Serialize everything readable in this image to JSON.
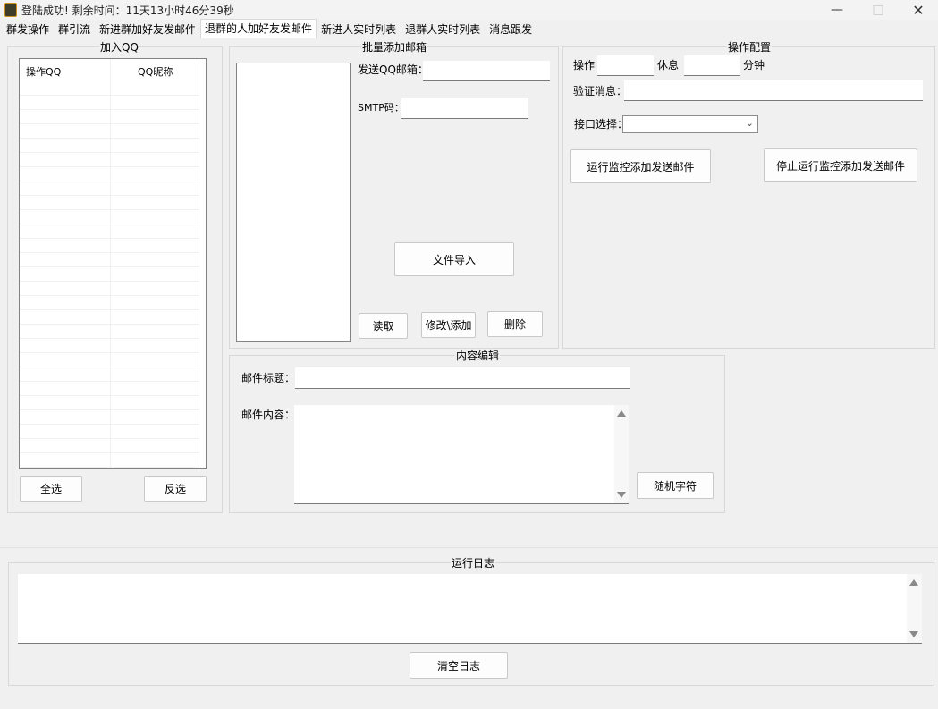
{
  "window": {
    "title": "登陆成功! 剩余时间：11天13小时46分39秒"
  },
  "tabs": [
    "群发操作",
    "群引流",
    "新进群加好友发邮件",
    "退群的人加好友发邮件",
    "新进人实时列表",
    "退群人实时列表",
    "消息跟发"
  ],
  "join_qq": {
    "title": "加入QQ",
    "columns": [
      "操作QQ",
      "QQ昵称"
    ],
    "select_all": "全选",
    "invert": "反选"
  },
  "batch_email": {
    "title": "批量添加邮箱",
    "sender_label": "发送QQ邮箱：",
    "smtp_label": "SMTP码：",
    "import_button": "文件导入",
    "read_button": "读取",
    "edit_button": "修改\\添加",
    "delete_button": "删除"
  },
  "config": {
    "title": "操作配置",
    "op_label": "操作",
    "rest_label": "休息",
    "minute_label": "分钟",
    "verify_label": "验证消息：",
    "api_label": "接口选择：",
    "run_button": "运行监控添加发送邮件",
    "stop_button": "停止运行监控添加发送邮件"
  },
  "content": {
    "title": "内容编辑",
    "subject_label": "邮件标题：",
    "body_label": "邮件内容：",
    "random_button": "随机字符"
  },
  "log": {
    "title": "运行日志",
    "clear_button": "清空日志"
  }
}
